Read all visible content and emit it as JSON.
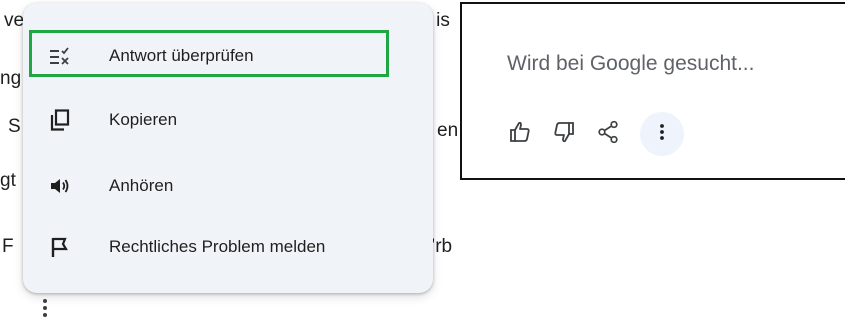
{
  "background_fragments": [
    {
      "id": "frag1",
      "text": "ve"
    },
    {
      "id": "frag2",
      "text": "'l is"
    },
    {
      "id": "frag3",
      "text": "ng"
    },
    {
      "id": "frag4",
      "text": "S"
    },
    {
      "id": "frag5",
      "text": "en"
    },
    {
      "id": "frag6",
      "text": "gt"
    },
    {
      "id": "frag7",
      "text": "F"
    },
    {
      "id": "frag8",
      "text": "’rb"
    }
  ],
  "menu": {
    "items": [
      {
        "label": "Antwort überprüfen",
        "icon": "check-response-icon"
      },
      {
        "label": "Kopieren",
        "icon": "copy-icon"
      },
      {
        "label": "Anhören",
        "icon": "speaker-icon"
      },
      {
        "label": "Rechtliches Problem melden",
        "icon": "flag-icon"
      }
    ],
    "highlighted_index": 0,
    "highlight_color": "#1fa745"
  },
  "panel": {
    "status_text": "Wird bei Google gesucht...",
    "actions": [
      {
        "icon": "thumbs-up-icon"
      },
      {
        "icon": "thumbs-down-icon"
      },
      {
        "icon": "share-icon"
      },
      {
        "icon": "more-vert-icon"
      }
    ]
  },
  "colors": {
    "menu_background": "#f0f4f9",
    "more_button_background": "#eef3fc",
    "text": "#1f1f1f",
    "muted_text": "#5f6368"
  }
}
